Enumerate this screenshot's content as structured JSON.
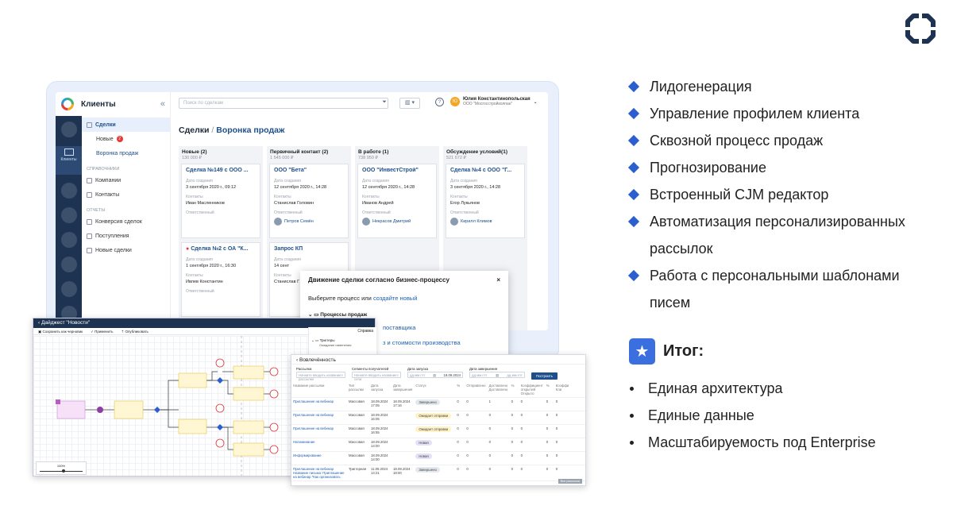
{
  "app": {
    "title": "Клиенты",
    "search_placeholder": "Поиск по сделкам",
    "user_name": "Юлия Константинопольская",
    "user_org": "ООО \"Мосгосстройколпан\"",
    "nav_active_label": "Клиенты",
    "breadcrumb_root": "Сделки",
    "breadcrumb_sep": " / ",
    "breadcrumb_current": "Воронка продаж"
  },
  "sidebar": {
    "deals": "Сделки",
    "new": "Новые",
    "new_badge": "2",
    "funnel": "Воронка продаж",
    "section_refs": "СПРАВОЧНИКИ",
    "companies": "Компании",
    "contacts": "Контакты",
    "section_reports": "ОТЧЕТЫ",
    "conversion": "Конверсия сделок",
    "income": "Поступления",
    "new_deals": "Новые сделки"
  },
  "columns": [
    {
      "title": "Новые (2)",
      "sum": "130 000 ₽"
    },
    {
      "title": "Первичный контакт (2)",
      "sum": "1 545 000 ₽"
    },
    {
      "title": "В работе (1)",
      "sum": "738 950 ₽"
    },
    {
      "title": "Обсуждение условий(1)",
      "sum": "521 672 ₽"
    }
  ],
  "labels": {
    "created": "Дата создания",
    "contacts": "Контакты",
    "responsible": "Ответственный"
  },
  "cards": [
    {
      "title": "Сделка №149 с ООО ...",
      "date": "3 сентября 2020 г., 09:12",
      "contact": "Иван Масленников",
      "resp": ""
    },
    {
      "title": "ООО \"Бета\"",
      "date": "12 сентября 2020 г., 14:28",
      "contact": "Станислав Головин",
      "resp": "Петров Семён"
    },
    {
      "title": "ООО \"ИнвестСтрой\"",
      "date": "12 сентября 2020 г., 14:28",
      "contact": "Иванов Андрей",
      "resp": "Некрасов Дмитрий"
    },
    {
      "title": "Сделка №4 с ООО \"Г...",
      "date": "3 сентября 2020 г., 14:28",
      "contact": "Егор Лукьянов",
      "resp": "Кирилл Климов"
    },
    {
      "title": "Сделка №2 с ОА \"К...",
      "date": "1 сентября 2020 г., 16:30",
      "contact": "Ивлев Константин",
      "resp": ""
    },
    {
      "title": "Запрос КП",
      "date": "14 сент",
      "contact": "Станислав Г",
      "resp": ""
    }
  ],
  "modal": {
    "title": "Движение сделки согласно бизнес-процессу",
    "close": "×",
    "prompt": "Выберите процесс или",
    "link": "создайте новый",
    "group": "Процессы продаж",
    "item1": "поставщика",
    "item2": "з и стоимости производства"
  },
  "diagram": {
    "title": "Дайджест \"Новости\"",
    "save": "Сохранить как черновик",
    "apply": "Применить",
    "publish": "Опубликовать",
    "help": "Справка",
    "triggers": "Триггеры",
    "waiting": "Ожидание изменения",
    "zoom": "100%"
  },
  "table": {
    "title": "Вовлечённость",
    "f_mailing": "Рассылка",
    "f_mailing_ph": "Начните вводить название рассылки",
    "f_recipients": "Сегменты получателей",
    "f_recipients_ph": "Начните вводить название сегм",
    "f_start": "Дата запуска",
    "f_end": "Дата завершения",
    "date_ph": "дд.мм.гггг",
    "date_val": "18.09.2024",
    "build": "Построить",
    "headers": [
      "Название рассылки",
      "Тип рассылки",
      "Дата запуска",
      "Дата завершения",
      "Статус",
      "Доставлено",
      "Коэффициент открытий",
      "Коэффи"
    ],
    "subheaders": [
      "%",
      "Отправлено",
      "Доставлено",
      "%",
      "Открыто",
      "%",
      "Кли"
    ],
    "rows": [
      {
        "name": "Приглашение на вебинар",
        "type": "Массовая",
        "start": "18.09.2024 17:05",
        "end": "18.09.2024 17:16",
        "status": "Завершено",
        "kind": "g",
        "v": [
          "0",
          "0",
          "1",
          "0",
          "0",
          "0",
          "0"
        ]
      },
      {
        "name": "Приглашение на вебинар",
        "type": "Массовая",
        "start": "18.09.2024 16:05",
        "end": "",
        "status": "Ожидает отправки",
        "kind": "y",
        "v": [
          "0",
          "0",
          "0",
          "0",
          "0",
          "0",
          "0"
        ]
      },
      {
        "name": "Приглашение на вебинар",
        "type": "Массовая",
        "start": "18.09.2024 16:55",
        "end": "",
        "status": "Ожидает отправки",
        "kind": "y",
        "v": [
          "0",
          "0",
          "0",
          "0",
          "0",
          "0",
          "0"
        ]
      },
      {
        "name": "Напоминание",
        "type": "Массовая",
        "start": "18.09.2024 14:00",
        "end": "",
        "status": "Новая",
        "kind": "p",
        "v": [
          "0",
          "0",
          "0",
          "0",
          "0",
          "0",
          "0"
        ]
      },
      {
        "name": "Информирование",
        "type": "Массовая",
        "start": "18.09.2024 14:00",
        "end": "",
        "status": "Новая",
        "kind": "p",
        "v": [
          "0",
          "0",
          "0",
          "0",
          "0",
          "0",
          "0"
        ]
      },
      {
        "name": "Приглашение на вебинар Название письма: Приглашение на вебинар \"Как организовать",
        "type": "Триггерная",
        "start": "11.09.2024 14:21",
        "end": "18.09.2024 18:00",
        "status": "Завершено",
        "kind": "g",
        "v": [
          "0",
          "0",
          "0",
          "0",
          "0",
          "0",
          "0"
        ]
      }
    ],
    "footer": "Все рассылки"
  },
  "features": [
    "Лидогенерация",
    "Управление профилем клиента",
    "Сквозной процесс продаж",
    "Прогнозирование",
    "Встроенный CJM редактор",
    "Автоматизация персонализированных рассылок",
    "Работа с персональными шаблонами писем"
  ],
  "summary": {
    "title": "Итог:",
    "items": [
      "Единая архитектура",
      "Единые данные",
      "Масштабируемость под Enterprise"
    ]
  },
  "colors": {
    "accent": "#2b5fd0",
    "nav": "#1e3352",
    "link": "#1d4f8c"
  }
}
